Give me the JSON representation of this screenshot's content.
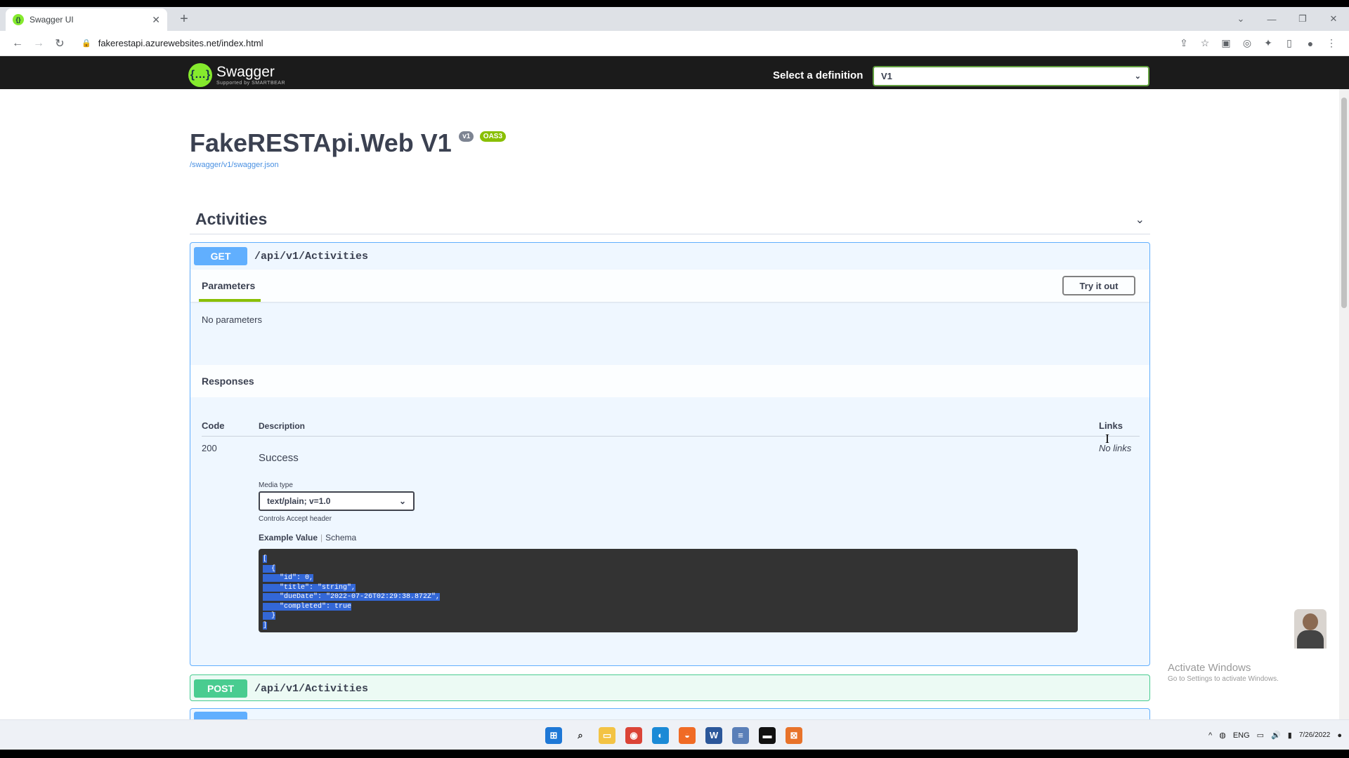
{
  "browser": {
    "tab_title": "Swagger UI",
    "url": "fakerestapi.azurewebsites.net/index.html"
  },
  "topbar": {
    "logo_name": "Swagger",
    "logo_sub": "Supported by SMARTBEAR",
    "definition_label": "Select a definition",
    "definition_value": "V1"
  },
  "info": {
    "title": "FakeRESTApi.Web V1",
    "version_badge": "v1",
    "oas_badge": "OAS3",
    "spec_link": "/swagger/v1/swagger.json"
  },
  "tag": {
    "name": "Activities"
  },
  "get_op": {
    "method": "GET",
    "path": "/api/v1/Activities",
    "params_tab": "Parameters",
    "try_button": "Try it out",
    "no_params": "No parameters",
    "responses_label": "Responses",
    "columns": {
      "code": "Code",
      "description": "Description",
      "links": "Links"
    },
    "response": {
      "code": "200",
      "description": "Success",
      "links": "No links",
      "media_type_label": "Media type",
      "media_type_value": "text/plain; v=1.0",
      "media_hint": "Controls Accept header",
      "example_tab": "Example Value",
      "schema_tab": "Schema",
      "example_lines": [
        "[",
        "  {",
        "    \"id\": 0,",
        "    \"title\": \"string\",",
        "    \"dueDate\": \"2022-07-26T02:29:38.872Z\",",
        "    \"completed\": true",
        "  }",
        "]"
      ]
    }
  },
  "post_op": {
    "method": "POST",
    "path": "/api/v1/Activities"
  },
  "watermark": {
    "line1": "Activate Windows",
    "line2": "Go to Settings to activate Windows."
  },
  "tray": {
    "lang": "ENG",
    "date": "7/26/2022"
  },
  "colors": {
    "get": "#61affe",
    "post": "#49cc90",
    "swagger_green": "#85ea2d",
    "topbar_bg": "#1b1b1b"
  }
}
